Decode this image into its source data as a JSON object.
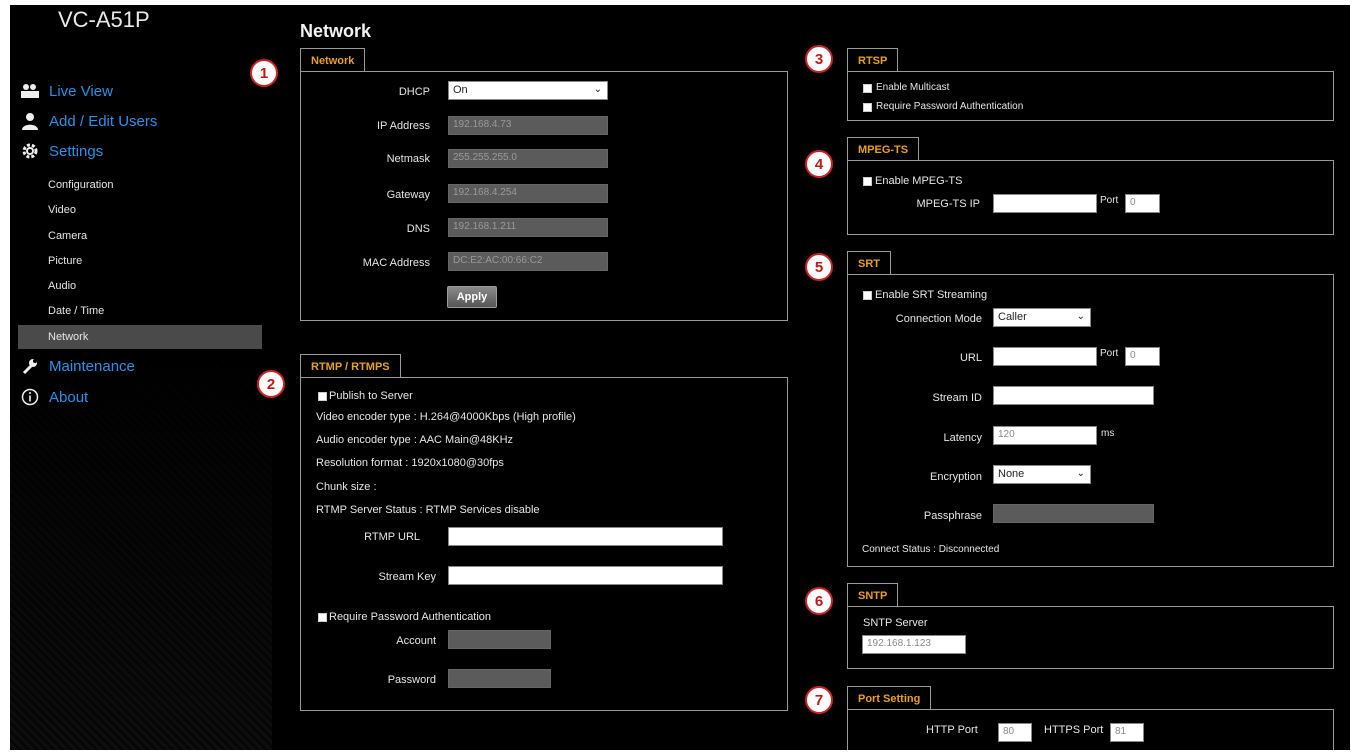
{
  "sidebar": {
    "model": "VC-A51P",
    "main_items": [
      {
        "label": "Live View",
        "icon": "camera-icon"
      },
      {
        "label": "Add / Edit Users",
        "icon": "user-icon"
      },
      {
        "label": "Settings",
        "icon": "gear-icon"
      },
      {
        "label": "Maintenance",
        "icon": "wrench-icon"
      },
      {
        "label": "About",
        "icon": "info-icon"
      }
    ],
    "settings_items": [
      "Configuration",
      "Video",
      "Camera",
      "Picture",
      "Audio",
      "Date / Time",
      "Network"
    ],
    "active_item": "Network"
  },
  "page": {
    "title": "Network"
  },
  "callouts": [
    "1",
    "2",
    "3",
    "4",
    "5",
    "6",
    "7"
  ],
  "network": {
    "tab": "Network",
    "dhcp_label": "DHCP",
    "dhcp_value": "On",
    "ip_label": "IP Address",
    "ip_value": "192.168.4.73",
    "netmask_label": "Netmask",
    "netmask_value": "255.255.255.0",
    "gateway_label": "Gateway",
    "gateway_value": "192.168.4.254",
    "dns_label": "DNS",
    "dns_value": "192.168.1.211",
    "mac_label": "MAC Address",
    "mac_value": "DC:E2:AC:00:66:C2",
    "apply_label": "Apply"
  },
  "rtmp": {
    "tab": "RTMP / RTMPS",
    "publish_label": "Publish to Server",
    "video_encoder": "Video encoder type : H.264@4000Kbps (High profile)",
    "audio_encoder": "Audio encoder type : AAC Main@48KHz",
    "resolution": "Resolution format : 1920x1080@30fps",
    "chunk_size": "Chunk size :",
    "server_status": "RTMP Server Status : RTMP Services disable",
    "url_label": "RTMP URL",
    "key_label": "Stream Key",
    "require_auth_label": "Require Password Authentication",
    "account_label": "Account",
    "password_label": "Password"
  },
  "rtsp": {
    "tab": "RTSP",
    "multicast_label": "Enable Multicast",
    "auth_label": "Require Password Authentication"
  },
  "mpegts": {
    "tab": "MPEG-TS",
    "enable_label": "Enable MPEG-TS",
    "ip_label": "MPEG-TS IP",
    "port_label": "Port",
    "port_value": "0"
  },
  "srt": {
    "tab": "SRT",
    "enable_label": "Enable SRT Streaming",
    "mode_label": "Connection Mode",
    "mode_value": "Caller",
    "url_label": "URL",
    "port_label": "Port",
    "port_value": "0",
    "stream_id_label": "Stream ID",
    "latency_label": "Latency",
    "latency_value": "120",
    "latency_unit": "ms",
    "encryption_label": "Encryption",
    "encryption_value": "None",
    "passphrase_label": "Passphrase",
    "status": "Connect Status : Disconnected"
  },
  "sntp": {
    "tab": "SNTP",
    "server_label": "SNTP Server",
    "server_value": "192.168.1.123"
  },
  "port_setting": {
    "tab": "Port Setting",
    "http_label": "HTTP Port",
    "http_value": "80",
    "https_label": "HTTPS Port",
    "https_value": "81"
  }
}
